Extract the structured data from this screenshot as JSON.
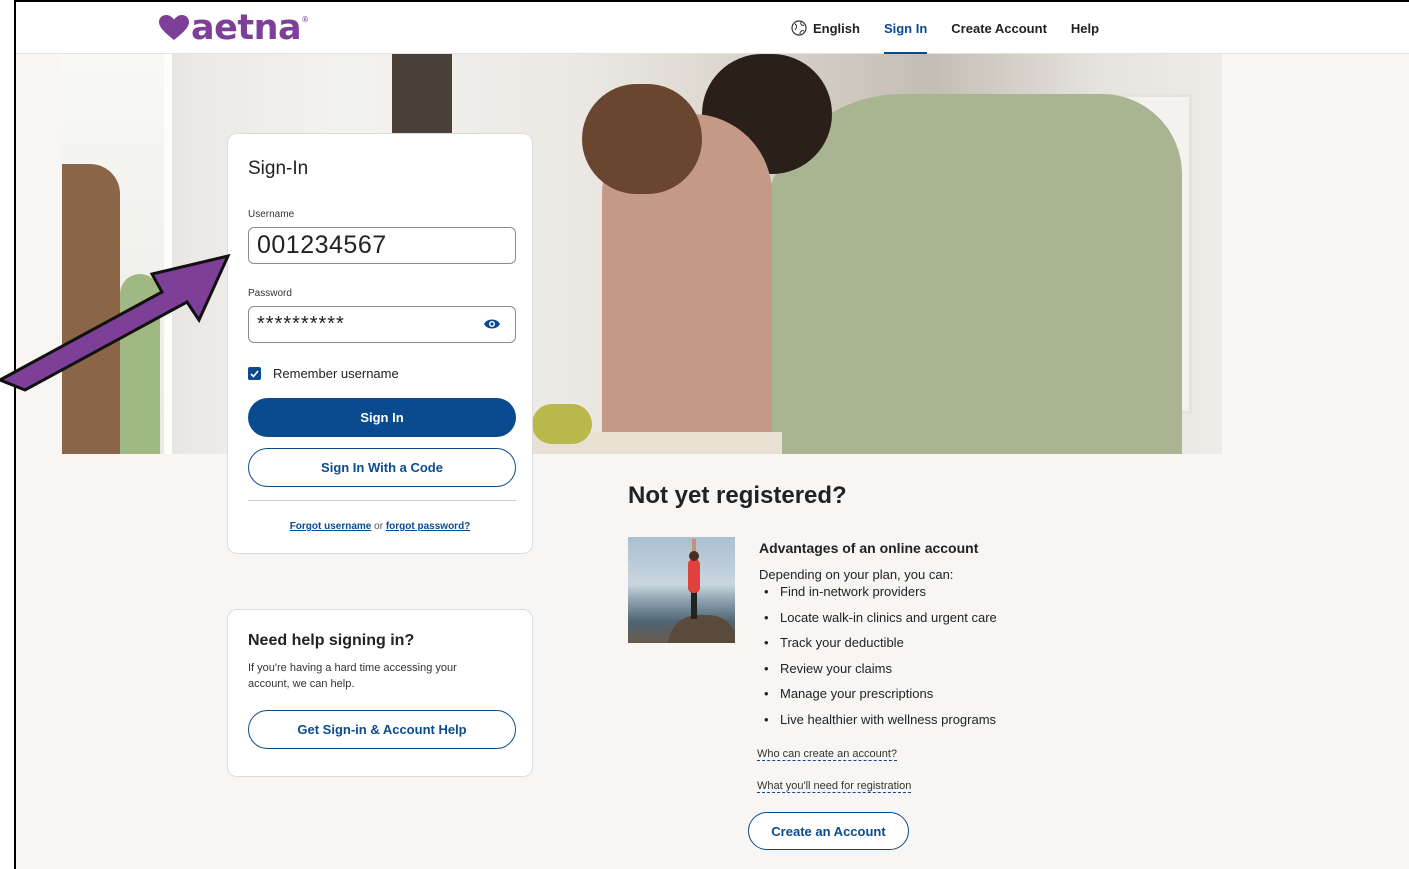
{
  "brand": {
    "name": "aetna",
    "trademark": "®",
    "color": "#7d3f98"
  },
  "nav": {
    "language": "English",
    "items": [
      {
        "label": "Sign In",
        "active": true
      },
      {
        "label": "Create Account",
        "active": false
      },
      {
        "label": "Help",
        "active": false
      }
    ]
  },
  "signin": {
    "title": "Sign-In",
    "username_label": "Username",
    "username_value": "001234567",
    "password_label": "Password",
    "password_value": "**********",
    "remember_label": "Remember username",
    "remember_checked": true,
    "sign_in_button": "Sign In",
    "code_button": "Sign In With a Code",
    "forgot_username": "Forgot username",
    "forgot_or": "or",
    "forgot_password": "forgot password?"
  },
  "help": {
    "title": "Need help signing in?",
    "text": "If you're having a hard time accessing your account, we can help.",
    "button": "Get Sign-in & Account Help"
  },
  "register": {
    "title": "Not yet registered?",
    "advantages_title": "Advantages of an online account",
    "intro": "Depending on your plan, you can:",
    "items": [
      "Find in-network providers",
      "Locate walk-in clinics and urgent care",
      "Track your deductible",
      "Review your claims",
      "Manage your prescriptions",
      "Live healthier with wellness programs"
    ],
    "link_who": "Who can create an account?",
    "link_need": "What you'll need for registration",
    "create_button": "Create an Account"
  },
  "colors": {
    "primary": "#0a4b8f",
    "arrow": "#7d3f98"
  }
}
